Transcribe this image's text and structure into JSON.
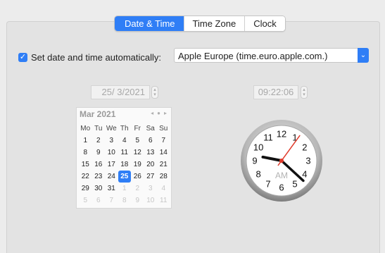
{
  "tabs": [
    {
      "label": "Date & Time",
      "active": true
    },
    {
      "label": "Time Zone",
      "active": false
    },
    {
      "label": "Clock",
      "active": false
    }
  ],
  "auto": {
    "checked": true,
    "check_glyph": "✓",
    "label": "Set date and time automatically:",
    "server": "Apple Europe (time.euro.apple.com.)",
    "dropdown_icon": "chevron-down-icon"
  },
  "date_field": "25/ 3/2021",
  "time_field": "09:22:06",
  "calendar": {
    "month": "Mar 2021",
    "nav": [
      "◂",
      "●",
      "▸"
    ],
    "weekdays": [
      "Mo",
      "Tu",
      "We",
      "Th",
      "Fr",
      "Sa",
      "Su"
    ],
    "weeks": [
      [
        "1",
        "2",
        "3",
        "4",
        "5",
        "6",
        "7"
      ],
      [
        "8",
        "9",
        "10",
        "11",
        "12",
        "13",
        "14"
      ],
      [
        "15",
        "16",
        "17",
        "18",
        "19",
        "20",
        "21"
      ],
      [
        "22",
        "23",
        "24",
        "25",
        "26",
        "27",
        "28"
      ],
      [
        "29",
        "30",
        "31",
        "1",
        "2",
        "3",
        "4"
      ],
      [
        "5",
        "6",
        "7",
        "8",
        "9",
        "10",
        "11"
      ]
    ],
    "selected": "25"
  },
  "clock": {
    "numbers": [
      "12",
      "1",
      "2",
      "3",
      "4",
      "5",
      "6",
      "7",
      "8",
      "9",
      "10",
      "11"
    ],
    "ampm": "AM",
    "hour": 9,
    "minute": 22,
    "second": 6,
    "hand_color": "#111111",
    "second_color": "#e03a2a"
  },
  "colors": {
    "accent": "#2f7ef6"
  }
}
